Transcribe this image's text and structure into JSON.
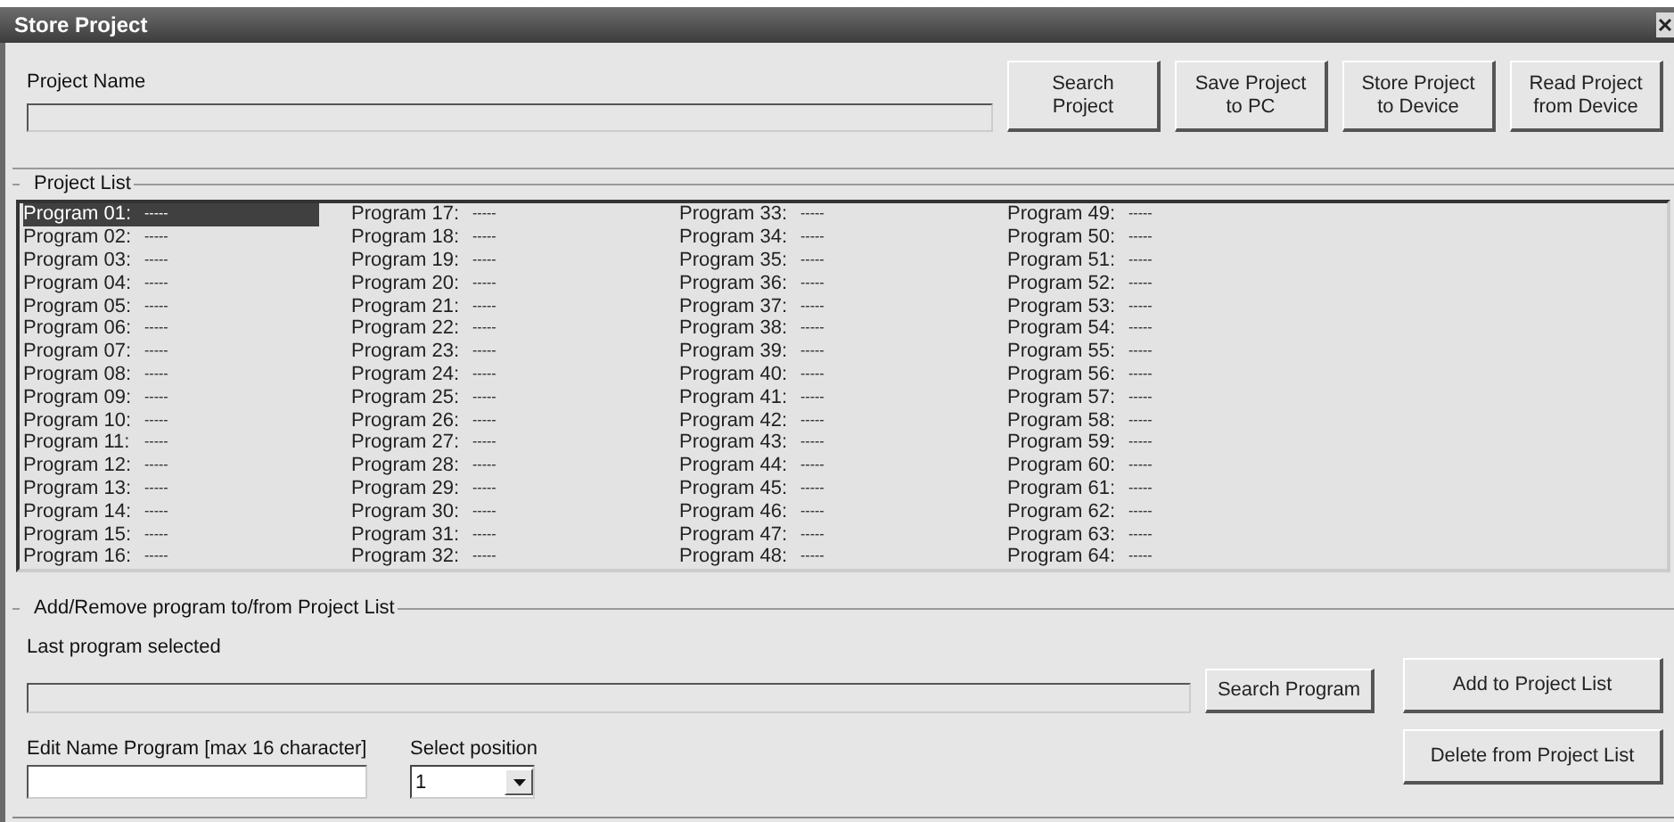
{
  "window": {
    "title": "Store Project"
  },
  "project_name": {
    "label": "Project Name"
  },
  "top_buttons": [
    {
      "label": "Search\nProject"
    },
    {
      "label": "Save Project\nto PC"
    },
    {
      "label": "Store Project\nto Device"
    },
    {
      "label": "Read Project\nfrom Device"
    }
  ],
  "project_list": {
    "title": "Project List",
    "items": [
      {
        "label": "Program 01:",
        "value": "-----",
        "selected": true
      },
      {
        "label": "Program 02:",
        "value": "-----",
        "selected": false
      },
      {
        "label": "Program 03:",
        "value": "-----",
        "selected": false
      },
      {
        "label": "Program 04:",
        "value": "-----",
        "selected": false
      },
      {
        "label": "Program 05:",
        "value": "-----",
        "selected": false
      },
      {
        "label": "Program 06:",
        "value": "-----",
        "selected": false
      },
      {
        "label": "Program 07:",
        "value": "-----",
        "selected": false
      },
      {
        "label": "Program 08:",
        "value": "-----",
        "selected": false
      },
      {
        "label": "Program 09:",
        "value": "-----",
        "selected": false
      },
      {
        "label": "Program 10:",
        "value": "-----",
        "selected": false
      },
      {
        "label": "Program 11:",
        "value": "-----",
        "selected": false
      },
      {
        "label": "Program 12:",
        "value": "-----",
        "selected": false
      },
      {
        "label": "Program 13:",
        "value": "-----",
        "selected": false
      },
      {
        "label": "Program 14:",
        "value": "-----",
        "selected": false
      },
      {
        "label": "Program 15:",
        "value": "-----",
        "selected": false
      },
      {
        "label": "Program 16:",
        "value": "-----",
        "selected": false
      },
      {
        "label": "Program 17:",
        "value": "-----",
        "selected": false
      },
      {
        "label": "Program 18:",
        "value": "-----",
        "selected": false
      },
      {
        "label": "Program 19:",
        "value": "-----",
        "selected": false
      },
      {
        "label": "Program 20:",
        "value": "-----",
        "selected": false
      },
      {
        "label": "Program 21:",
        "value": "-----",
        "selected": false
      },
      {
        "label": "Program 22:",
        "value": "-----",
        "selected": false
      },
      {
        "label": "Program 23:",
        "value": "-----",
        "selected": false
      },
      {
        "label": "Program 24:",
        "value": "-----",
        "selected": false
      },
      {
        "label": "Program 25:",
        "value": "-----",
        "selected": false
      },
      {
        "label": "Program 26:",
        "value": "-----",
        "selected": false
      },
      {
        "label": "Program 27:",
        "value": "-----",
        "selected": false
      },
      {
        "label": "Program 28:",
        "value": "-----",
        "selected": false
      },
      {
        "label": "Program 29:",
        "value": "-----",
        "selected": false
      },
      {
        "label": "Program 30:",
        "value": "-----",
        "selected": false
      },
      {
        "label": "Program 31:",
        "value": "-----",
        "selected": false
      },
      {
        "label": "Program 32:",
        "value": "-----",
        "selected": false
      },
      {
        "label": "Program 33:",
        "value": "-----",
        "selected": false
      },
      {
        "label": "Program 34:",
        "value": "-----",
        "selected": false
      },
      {
        "label": "Program 35:",
        "value": "-----",
        "selected": false
      },
      {
        "label": "Program 36:",
        "value": "-----",
        "selected": false
      },
      {
        "label": "Program 37:",
        "value": "-----",
        "selected": false
      },
      {
        "label": "Program 38:",
        "value": "-----",
        "selected": false
      },
      {
        "label": "Program 39:",
        "value": "-----",
        "selected": false
      },
      {
        "label": "Program 40:",
        "value": "-----",
        "selected": false
      },
      {
        "label": "Program 41:",
        "value": "-----",
        "selected": false
      },
      {
        "label": "Program 42:",
        "value": "-----",
        "selected": false
      },
      {
        "label": "Program 43:",
        "value": "-----",
        "selected": false
      },
      {
        "label": "Program 44:",
        "value": "-----",
        "selected": false
      },
      {
        "label": "Program 45:",
        "value": "-----",
        "selected": false
      },
      {
        "label": "Program 46:",
        "value": "-----",
        "selected": false
      },
      {
        "label": "Program 47:",
        "value": "-----",
        "selected": false
      },
      {
        "label": "Program 48:",
        "value": "-----",
        "selected": false
      },
      {
        "label": "Program 49:",
        "value": "-----",
        "selected": false
      },
      {
        "label": "Program 50:",
        "value": "-----",
        "selected": false
      },
      {
        "label": "Program 51:",
        "value": "-----",
        "selected": false
      },
      {
        "label": "Program 52:",
        "value": "-----",
        "selected": false
      },
      {
        "label": "Program 53:",
        "value": "-----",
        "selected": false
      },
      {
        "label": "Program 54:",
        "value": "-----",
        "selected": false
      },
      {
        "label": "Program 55:",
        "value": "-----",
        "selected": false
      },
      {
        "label": "Program 56:",
        "value": "-----",
        "selected": false
      },
      {
        "label": "Program 57:",
        "value": "-----",
        "selected": false
      },
      {
        "label": "Program 58:",
        "value": "-----",
        "selected": false
      },
      {
        "label": "Program 59:",
        "value": "-----",
        "selected": false
      },
      {
        "label": "Program 60:",
        "value": "-----",
        "selected": false
      },
      {
        "label": "Program 61:",
        "value": "-----",
        "selected": false
      },
      {
        "label": "Program 62:",
        "value": "-----",
        "selected": false
      },
      {
        "label": "Program 63:",
        "value": "-----",
        "selected": false
      },
      {
        "label": "Program 64:",
        "value": "-----",
        "selected": false
      }
    ]
  },
  "add_remove": {
    "title": "Add/Remove program to/from Project List",
    "last_program": {
      "label": "Last program selected"
    },
    "search_button": "Search Program",
    "edit_name": {
      "label": "Edit Name Program [max 16 character]"
    },
    "position": {
      "label": "Select position",
      "value": "1"
    },
    "add_button": "Add to Project List",
    "delete_button": "Delete from Project List"
  }
}
